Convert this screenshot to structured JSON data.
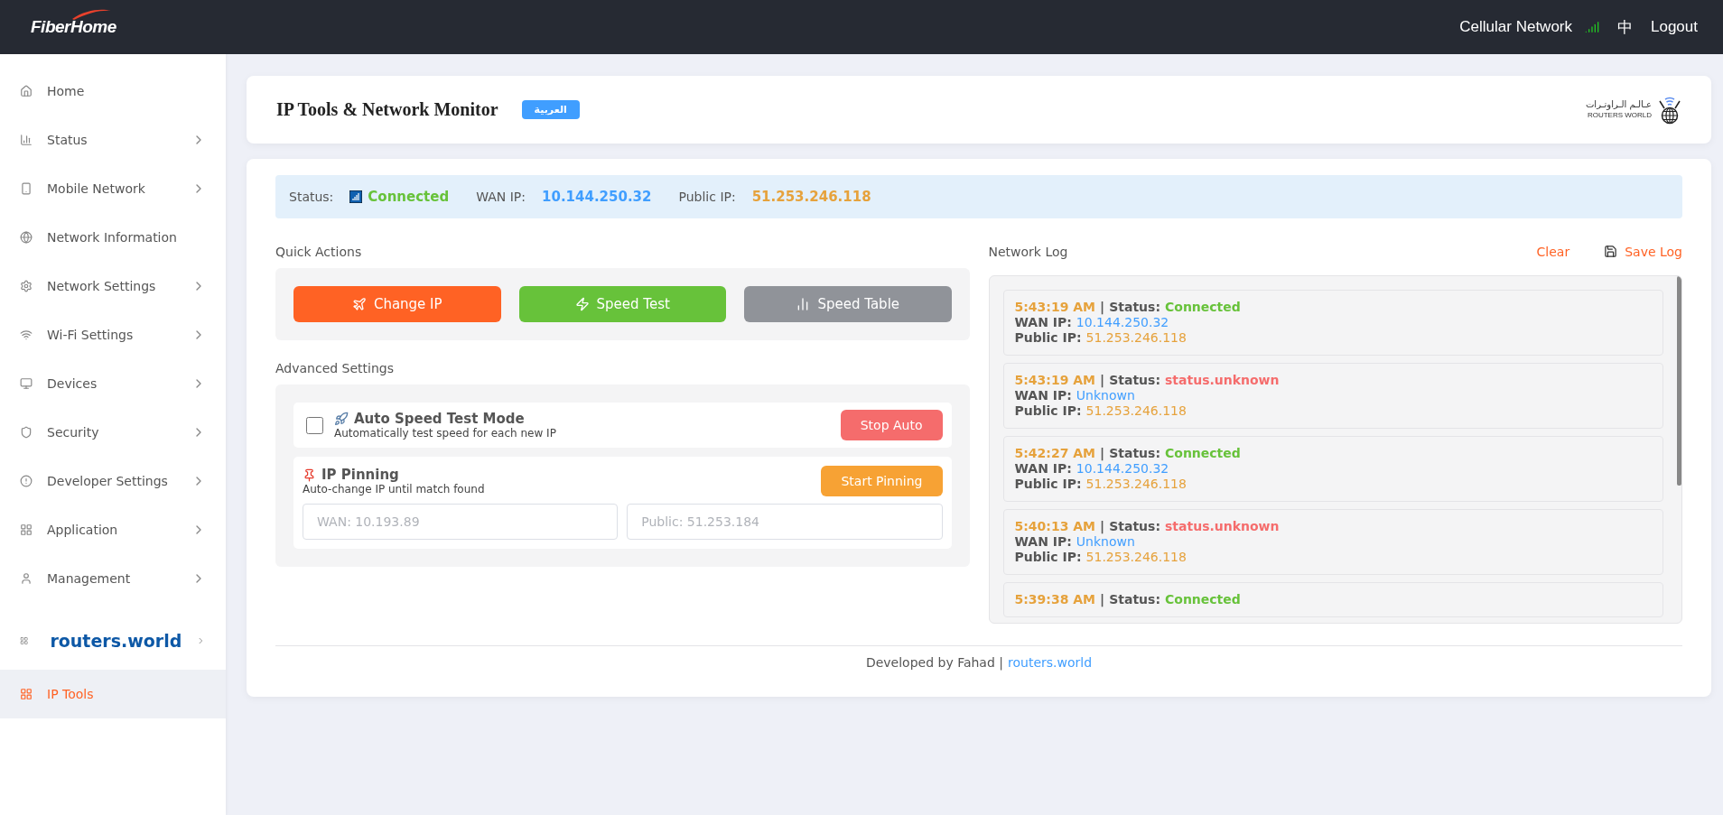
{
  "header": {
    "logo": "FiberHome",
    "network": "Cellular Network",
    "language": "中",
    "logout": "Logout"
  },
  "sidebar": {
    "items": [
      {
        "label": "Home",
        "kind": "page",
        "has_submenu": false,
        "selected": false
      },
      {
        "label": "Status",
        "kind": "page",
        "has_submenu": true,
        "selected": false
      },
      {
        "label": "Mobile Network",
        "kind": "page",
        "has_submenu": true,
        "selected": false
      },
      {
        "label": "Network Information",
        "kind": "page",
        "has_submenu": false,
        "selected": false
      },
      {
        "label": "Network Settings",
        "kind": "page",
        "has_submenu": true,
        "selected": false
      },
      {
        "label": "Wi-Fi Settings",
        "kind": "page",
        "has_submenu": true,
        "selected": false
      },
      {
        "label": "Devices",
        "kind": "page",
        "has_submenu": true,
        "selected": false
      },
      {
        "label": "Security",
        "kind": "page",
        "has_submenu": true,
        "selected": false
      },
      {
        "label": "Developer Settings",
        "kind": "page",
        "has_submenu": true,
        "selected": false
      },
      {
        "label": "Application",
        "kind": "page",
        "has_submenu": true,
        "selected": false
      },
      {
        "label": "Management",
        "kind": "page",
        "has_submenu": true,
        "selected": false
      },
      {
        "label": "routers.world",
        "kind": "brand",
        "has_submenu": true,
        "selected": false
      },
      {
        "label": "IP Tools",
        "kind": "page",
        "has_submenu": false,
        "selected": true
      }
    ]
  },
  "title_card": {
    "title": "IP Tools & Network Monitor",
    "language_button": "العربية",
    "brand_arabic": "عـالـم الـراوتـرات",
    "brand_latin": "ROUTERS WORLD"
  },
  "status_bar": {
    "status_label": "Status:",
    "status_value": "Connected",
    "wan_label": "WAN IP:",
    "wan_value": "10.144.250.32",
    "public_label": "Public IP:",
    "public_value": "51.253.246.118"
  },
  "quick_actions": {
    "heading": "Quick Actions",
    "buttons": [
      {
        "label": "Change IP",
        "color": "#ff6224"
      },
      {
        "label": "Speed Test",
        "color": "#67c23a"
      },
      {
        "label": "Speed Table",
        "color": "#909399"
      }
    ]
  },
  "advanced": {
    "heading": "Advanced Settings",
    "auto_speed": {
      "title": "Auto Speed Test Mode",
      "description": "Automatically test speed for each new IP",
      "checked": false,
      "button": "Stop Auto"
    },
    "ip_pinning": {
      "title": "IP Pinning",
      "description": "Auto-change IP until match found",
      "button": "Start Pinning",
      "wan_placeholder": "WAN: 10.193.89",
      "public_placeholder": "Public: 51.253.184"
    }
  },
  "network_log": {
    "heading": "Network Log",
    "clear": "Clear",
    "save": "Save Log",
    "entries": [
      {
        "time": "5:43:19 AM",
        "separator": "|",
        "status_label": "Status:",
        "status": "Connected",
        "kind": "connected",
        "wan_label": "WAN IP:",
        "wan": "10.144.250.32",
        "public_label": "Public IP:",
        "public": "51.253.246.118"
      },
      {
        "time": "5:43:19 AM",
        "separator": "|",
        "status_label": "Status:",
        "status": "status.unknown",
        "kind": "unknown",
        "wan_label": "WAN IP:",
        "wan": "Unknown",
        "public_label": "Public IP:",
        "public": "51.253.246.118"
      },
      {
        "time": "5:42:27 AM",
        "separator": "|",
        "status_label": "Status:",
        "status": "Connected",
        "kind": "connected",
        "wan_label": "WAN IP:",
        "wan": "10.144.250.32",
        "public_label": "Public IP:",
        "public": "51.253.246.118"
      },
      {
        "time": "5:40:13 AM",
        "separator": "|",
        "status_label": "Status:",
        "status": "status.unknown",
        "kind": "unknown",
        "wan_label": "WAN IP:",
        "wan": "Unknown",
        "public_label": "Public IP:",
        "public": "51.253.246.118"
      },
      {
        "time": "5:39:38 AM",
        "separator": "|",
        "status_label": "Status:",
        "status": "Connected",
        "kind": "connected"
      }
    ]
  },
  "footer": {
    "text": "Developed by Fahad |",
    "link": "routers.world"
  }
}
